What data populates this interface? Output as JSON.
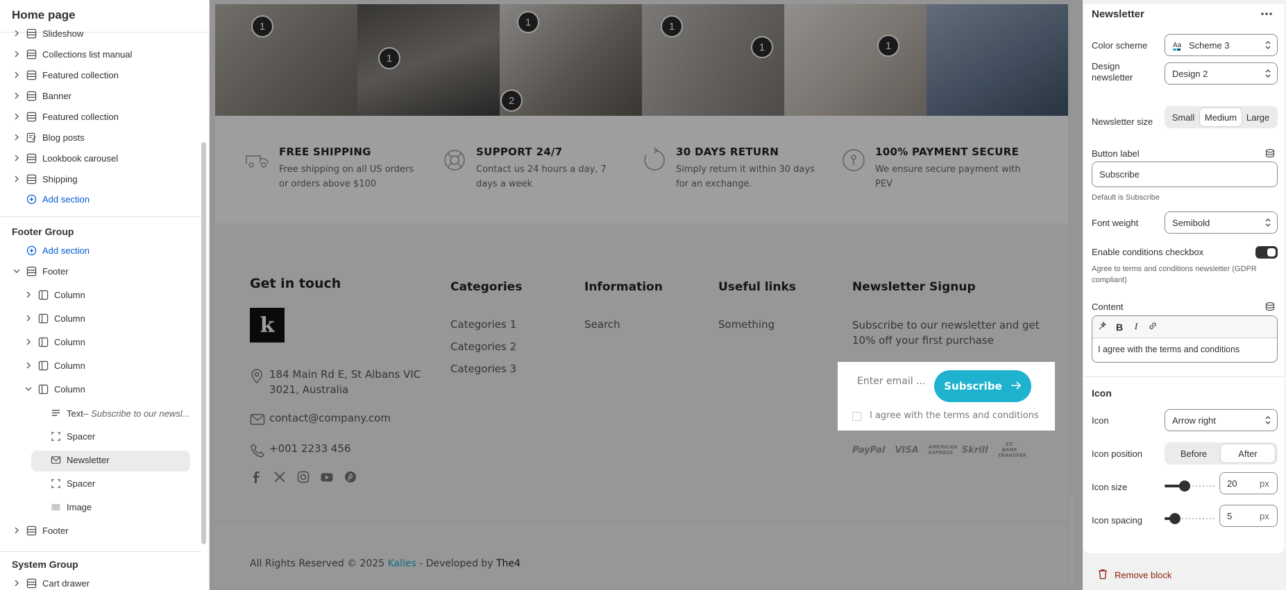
{
  "left": {
    "title": "Home page",
    "sections": [
      {
        "label": "Slideshow",
        "icon": "layout-icon"
      },
      {
        "label": "Collections list manual",
        "icon": "layout-icon"
      },
      {
        "label": "Featured collection",
        "icon": "layout-icon"
      },
      {
        "label": "Banner",
        "icon": "layout-icon"
      },
      {
        "label": "Featured collection",
        "icon": "layout-icon"
      },
      {
        "label": "Blog posts",
        "icon": "blog-icon"
      },
      {
        "label": "Lookbook carousel",
        "icon": "layout-icon"
      },
      {
        "label": "Shipping",
        "icon": "layout-icon"
      }
    ],
    "add_section": "Add section",
    "footer_group": "Footer Group",
    "footer_add_section": "Add section",
    "footer": "Footer",
    "columns": [
      "Column",
      "Column",
      "Column",
      "Column",
      "Column"
    ],
    "blocks": [
      {
        "label": "Text",
        "extra": "Subscribe to our newsl..."
      },
      {
        "label": "Spacer",
        "extra": ""
      },
      {
        "label": "Newsletter",
        "extra": ""
      },
      {
        "label": "Spacer",
        "extra": ""
      },
      {
        "label": "Image",
        "extra": ""
      }
    ],
    "footer2": "Footer",
    "system_group": "System Group",
    "cart_drawer": "Cart drawer"
  },
  "preview": {
    "hotspots": [
      "1",
      "1",
      "1",
      "1",
      "2",
      "1",
      "1"
    ],
    "features": [
      {
        "title": "FREE SHIPPING",
        "text": "Free shipping on all US orders or orders above $100",
        "icon": "truck-icon"
      },
      {
        "title": "SUPPORT 24/7",
        "text": "Contact us 24 hours a day, 7 days a week",
        "icon": "lifebuoy-icon"
      },
      {
        "title": "30 DAYS RETURN",
        "text": "Simply return it within 30 days for an exchange.",
        "icon": "return-icon"
      },
      {
        "title": "100% PAYMENT SECURE",
        "text": "We ensure secure payment with PEV",
        "icon": "secure-icon"
      }
    ],
    "footer": {
      "get_in_touch": "Get in touch",
      "logo_letter": "k",
      "address": "184 Main Rd E, St Albans VIC 3021, Australia",
      "email": "contact@company.com",
      "phone": "+001 2233 456",
      "categories_title": "Categories",
      "categories": [
        "Categories 1",
        "Categories 2",
        "Categories 3"
      ],
      "information_title": "Information",
      "information": [
        "Search"
      ],
      "useful_title": "Useful links",
      "useful": [
        "Something"
      ],
      "newsletter_title": "Newsletter Signup",
      "newsletter_text": "Subscribe to our newsletter and get 10% off your first purchase",
      "email_placeholder": "Enter email ...",
      "subscribe": "Subscribe",
      "agree": "I agree with the terms and conditions",
      "payments": [
        "PayPal",
        "VISA",
        "AMERICAN EXPRESS",
        "Skrill",
        "ST. BANK TRANSFER"
      ],
      "copyright_prefix": "All Rights Reserved © 2025",
      "brand": "Kalles",
      "dev_prefix": "- Developed by",
      "dev": "The4"
    },
    "accent": "#1fb2cf"
  },
  "panel": {
    "title": "Newsletter",
    "color_scheme_label": "Color scheme",
    "color_scheme_value": "Scheme 3",
    "design_label": "Design newsletter",
    "design_value": "Design 2",
    "size_label": "Newsletter size",
    "sizes": [
      "Small",
      "Medium",
      "Large"
    ],
    "size_selected": "Medium",
    "button_label_label": "Button label",
    "button_label_value": "Subscribe",
    "button_label_help": "Default is Subscribe",
    "font_weight_label": "Font weight",
    "font_weight_value": "Semibold",
    "conditions_label": "Enable conditions checkbox",
    "conditions_on": true,
    "conditions_help": "Agree to terms and conditions newsletter (GDPR compliant)",
    "content_label": "Content",
    "content_value": "I agree with the terms and conditions",
    "icon_heading": "Icon",
    "icon_label": "Icon",
    "icon_value": "Arrow right",
    "icon_position_label": "Icon position",
    "icon_positions": [
      "Before",
      "After"
    ],
    "icon_position_selected": "After",
    "icon_size_label": "Icon size",
    "icon_size_value": "20",
    "icon_spacing_label": "Icon spacing",
    "icon_spacing_value": "5",
    "unit": "px",
    "remove": "Remove block"
  }
}
